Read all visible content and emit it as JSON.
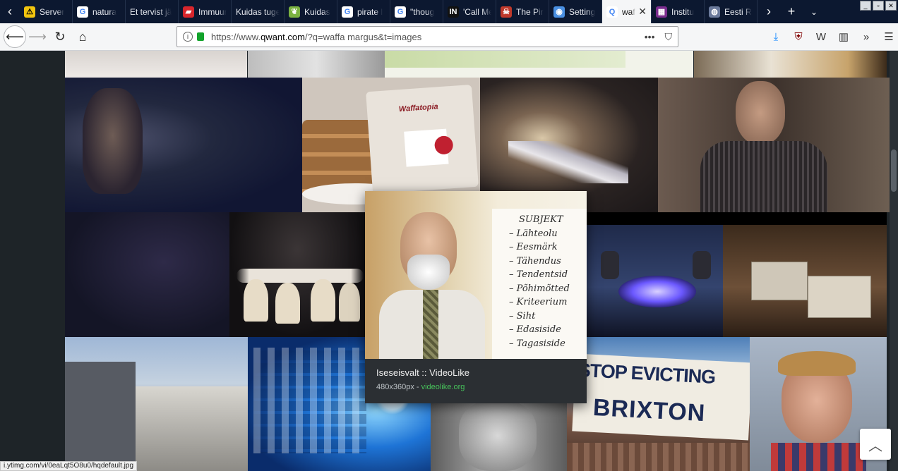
{
  "browser": {
    "tabs": [
      {
        "label": "Server",
        "icon": "warning-icon",
        "color": "#f1c40f"
      },
      {
        "label": "natura",
        "icon": "google-icon",
        "color": "#ffffff"
      },
      {
        "label": "Et tervist jä",
        "icon": "none",
        "color": "#0c1830"
      },
      {
        "label": "Immuur",
        "icon": "brand-icon",
        "color": "#d8262c"
      },
      {
        "label": "Kuidas tuge",
        "icon": "none",
        "color": "#0c1830"
      },
      {
        "label": "Kuidas",
        "icon": "leaf-icon",
        "color": "#7bb241"
      },
      {
        "label": "pirate l",
        "icon": "google-icon",
        "color": "#ffffff"
      },
      {
        "label": "\"thoug",
        "icon": "google-icon",
        "color": "#ffffff"
      },
      {
        "label": "'Call Me",
        "icon": "in-icon",
        "color": "#111111"
      },
      {
        "label": "The Pir",
        "icon": "pirate-icon",
        "color": "#c0392b"
      },
      {
        "label": "Setting",
        "icon": "chrome-icon",
        "color": "#4a90e2"
      },
      {
        "label": "waf",
        "icon": "qwant-icon",
        "color": "#ffffff",
        "active": true
      },
      {
        "label": "Institu",
        "icon": "grid-icon",
        "color": "#7b2d8e"
      },
      {
        "label": "Eesti R",
        "icon": "globe-icon",
        "color": "#6b7a9b"
      }
    ],
    "url_prefix": "https://www.",
    "url_host": "qwant.com",
    "url_rest": "/?q=waffa margus&t=images"
  },
  "tooltip": {
    "title": "Iseseisvalt :: VideoLike",
    "size": "480x360px",
    "separator": " - ",
    "source": "videolike.org",
    "board_lines": [
      "SUBJEKT",
      "Lähteolu",
      "Eesmärk",
      "Tähendus",
      "Tendentsid",
      "Põhimõtted",
      "Kriteerium",
      "Siht",
      "Edasiside",
      "Tagasiside"
    ]
  },
  "image_texts": {
    "waffle_brand": "Waffatopia",
    "protest_line1": "STOP EVICTING",
    "protest_line2": "BRIXTON"
  },
  "status_url": "i.ytimg.com/vi/0eaLqt5O8u0/hqdefault.jpg"
}
